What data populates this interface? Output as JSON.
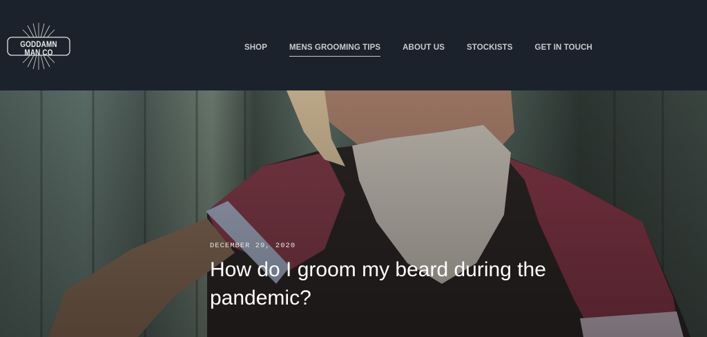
{
  "header": {
    "logo": {
      "text": "GODDAMN MAN CO"
    },
    "nav": [
      {
        "label": "SHOP",
        "active": false
      },
      {
        "label": "MENS GROOMING TIPS",
        "active": true
      },
      {
        "label": "ABOUT US",
        "active": false
      },
      {
        "label": "STOCKISTS",
        "active": false
      },
      {
        "label": "GET IN TOUCH",
        "active": false
      }
    ]
  },
  "hero": {
    "date": "DECEMBER 29, 2020",
    "title": "How do I groom my beard during the pandemic?"
  },
  "colors": {
    "header_bg": "#1c222b",
    "nav_text": "#c9cccf",
    "title_text": "#ffffff"
  }
}
